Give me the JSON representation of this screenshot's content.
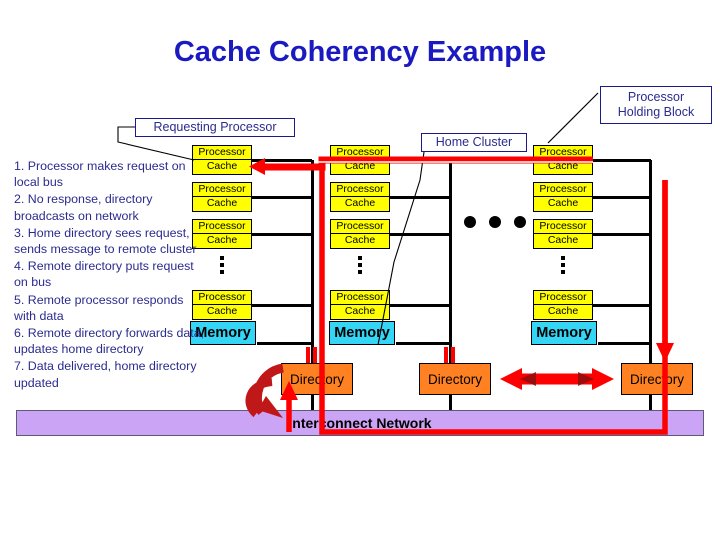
{
  "title": "Cache Coherency Example",
  "callouts": {
    "requesting": "Requesting Processor",
    "home": "Home Cluster",
    "holding_line1": "Processor",
    "holding_line2": "Holding Block"
  },
  "steps": [
    "1. Processor makes request on local bus",
    "2. No response, directory broadcasts on network",
    "3. Home directory sees request, sends message to remote cluster",
    "4. Remote directory puts request on bus",
    "5. Remote processor responds with data",
    "6. Remote directory forwards data, updates home directory",
    "7. Data delivered, home directory updated"
  ],
  "labels": {
    "processor": "Processor",
    "cache": "Cache",
    "memory": "Memory",
    "directory": "Directory",
    "network": "Interconnect Network"
  },
  "clusters": [
    {
      "name": "requesting-cluster",
      "nodes": [
        {
          "processor": "Processor",
          "cache": "Cache"
        },
        {
          "processor": "Processor",
          "cache": "Cache"
        },
        {
          "processor": "Processor",
          "cache": "Cache"
        },
        {
          "processor": "Processor",
          "cache": "Cache"
        }
      ],
      "memory": "Memory",
      "directory": "Directory"
    },
    {
      "name": "home-cluster",
      "nodes": [
        {
          "processor": "Processor",
          "cache": "Cache"
        },
        {
          "processor": "Processor",
          "cache": "Cache"
        },
        {
          "processor": "Processor",
          "cache": "Cache"
        },
        {
          "processor": "Processor",
          "cache": "Cache"
        }
      ],
      "memory": "Memory",
      "directory": "Directory"
    },
    {
      "name": "remote-cluster",
      "nodes": [
        {
          "processor": "Processor",
          "cache": "Cache"
        },
        {
          "processor": "Processor",
          "cache": "Cache"
        },
        {
          "processor": "Processor",
          "cache": "Cache"
        },
        {
          "processor": "Processor",
          "cache": "Cache"
        }
      ],
      "memory": "Memory",
      "directory": "Directory"
    }
  ],
  "colors": {
    "title": "#1a1ac0",
    "cache_box": "#ffff00",
    "memory_box": "#34d5f5",
    "directory_box": "#ff8122",
    "network_bar": "#cba4f5",
    "arrow_red": "#ff0000",
    "arrow_dark_red": "#c01818",
    "text_blue": "#2b2b8f"
  }
}
